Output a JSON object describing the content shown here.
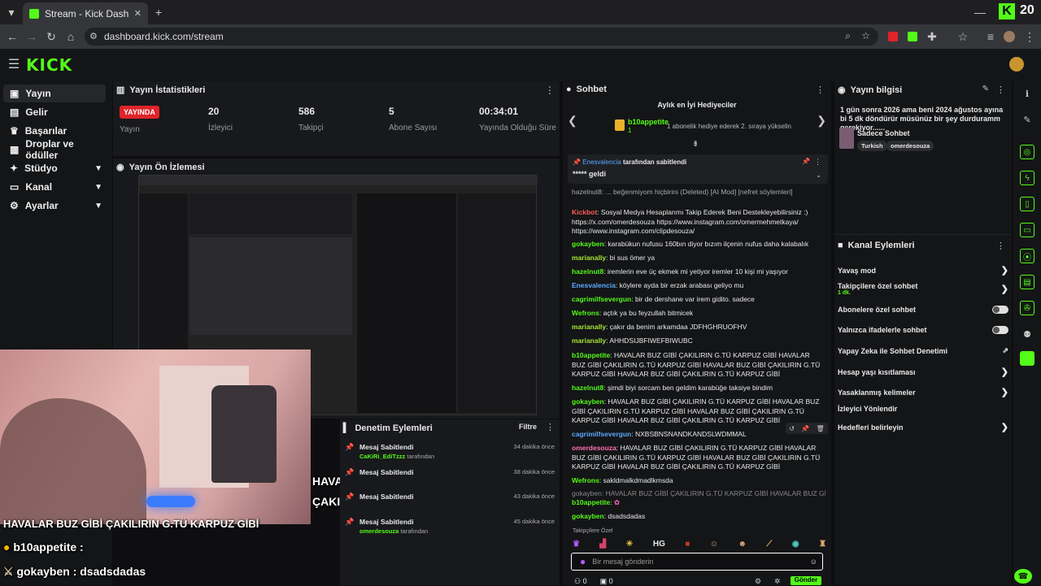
{
  "browser": {
    "tab_title": "Stream - Kick Dashboard",
    "url": "dashboard.kick.com/stream"
  },
  "logo": "KICK",
  "sidebar": {
    "items": [
      {
        "label": "Yayın",
        "icon": "broadcast-icon"
      },
      {
        "label": "Gelir",
        "icon": "wallet-icon"
      },
      {
        "label": "Başarılar",
        "icon": "trophy-icon"
      },
      {
        "label": "Droplar ve ödüller",
        "icon": "gift-icon"
      },
      {
        "label": "Stüdyo",
        "icon": "studio-icon"
      },
      {
        "label": "Kanal",
        "icon": "channel-icon"
      },
      {
        "label": "Ayarlar",
        "icon": "settings-icon"
      }
    ]
  },
  "stats": {
    "title": "Yayın İstatistikleri",
    "live_badge": "YAYINDA",
    "items": [
      {
        "label": "Yayın"
      },
      {
        "value": "20",
        "label": "İzleyici"
      },
      {
        "value": "586",
        "label": "Takipçi"
      },
      {
        "value": "5",
        "label": "Abone Sayısı"
      },
      {
        "value": "00:34:01",
        "label": "Yayında Olduğu Süre"
      }
    ]
  },
  "preview": {
    "title": "Yayın Ön İzlemesi"
  },
  "overlay": {
    "l1": "HAVALAR BUZ GİBİ",
    "l2": "ÇAKILIRIN G.TÜ KARPUZ GİBİ",
    "l3": "HAVALAR BUZ GİBİ ÇAKILIRIN G.TÜ KARPUZ GİBİ",
    "u1": "b10appetite :",
    "u2": "gokayben : dsadsdadas",
    "viewers": "20"
  },
  "moderation": {
    "title": "Denetim Eylemleri",
    "filter": "Filtre",
    "items": [
      {
        "title": "Mesaj Sabitlendi",
        "user": "CaKiRi_EdiTzzz",
        "suffix": "tarafından",
        "time": "34 dakika önce"
      },
      {
        "title": "Mesaj Sabitlendi",
        "user": "",
        "suffix": "",
        "time": "38 dakika önce"
      },
      {
        "title": "Mesaj Sabitlendi",
        "user": "",
        "suffix": "",
        "time": "43 dakika önce"
      },
      {
        "title": "Mesaj Sabitlendi",
        "user": "omerdesouza",
        "suffix": "tarafından",
        "time": "45 dakika önce"
      }
    ]
  },
  "chat": {
    "title": "Sohbet",
    "top_gifters": "Aylık en İyi Hediyeciler",
    "gifter_name": "b10appetite",
    "gifter_count": "1",
    "gifter_hint": "1 abonelik hediye ederek 2. sıraya yükselin",
    "pinned_by": "Enesvalencia",
    "pinned_by_suffix": "tarafından sabitlendi",
    "pinned_text": "***** geldi",
    "cutoff": "hazelnut8: ... beğenmiyom hiçbirini (Deleted) [AI Mod] [nefret söylemleri]",
    "messages": [
      {
        "u": "Kickbot",
        "c": "u-red",
        "t": "Sosyal Medya Hesaplarımı Takip Ederek Beni Destekleyebilirsiniz :) https://x.com/omerdesouza https://www.instagram.com/omermehmetkaya/ https://www.instagram.com/clipdesouza/"
      },
      {
        "u": "gokayben",
        "c": "u-green",
        "t": "karabükun nufusu 160bın diyor bızım ilçenin nufus daha kalabalık"
      },
      {
        "u": "marianally",
        "c": "u-green",
        "t": "bi sus ömer ya"
      },
      {
        "u": "hazelnut8",
        "c": "u-green",
        "t": "iremlerin eve üç ekmek mi yetiyor iremler 10 kişi mi yaşıyor"
      },
      {
        "u": "Enesvalencia",
        "c": "u-blue",
        "t": "köylere ayda bir erzak arabası geliyo mu"
      },
      {
        "u": "cagrimilfsevergun",
        "c": "u-green",
        "t": "bir de dershane var irem gidito. sadece"
      },
      {
        "u": "Wefrons",
        "c": "u-green",
        "t": "açtık ya bu feyzullah bitmicek"
      },
      {
        "u": "marianally",
        "c": "u-green",
        "t": "çakır da benim arkamdaa JDFHGHRUOFHV"
      },
      {
        "u": "marianally",
        "c": "u-green",
        "t": "AHHDSIJBFIWEFBIWUBC"
      },
      {
        "u": "b10appetite",
        "c": "u-green",
        "t": "HAVALAR BUZ GİBİ ÇAKILIRIN G.TÜ KARPUZ GİBİ HAVALAR BUZ GİBİ ÇAKILIRIN G.TÜ KARPUZ GİBİ HAVALAR BUZ GİBİ ÇAKILIRIN G.TÜ KARPUZ GİBİ HAVALAR BUZ GİBİ ÇAKILIRIN G.TÜ KARPUZ GİBİ"
      },
      {
        "u": "hazelnut8",
        "c": "u-green",
        "t": "şimdi biyi sorcam ben geldim karabüğe taksiye bindim"
      },
      {
        "u": "gokayben",
        "c": "u-green",
        "t": "HAVALAR BUZ GİBİ ÇAKILIRIN G.TÜ KARPUZ GİBİ HAVALAR BUZ GİBİ ÇAKILIRIN G.TÜ KARPUZ GİBİ HAVALAR BUZ GİBİ ÇAKILIRIN G.TÜ KARPUZ GİBİ HAVALAR BUZ GİBİ ÇAKILIRIN G.TÜ KARPUZ GİBİ"
      },
      {
        "u": "cagrimilfsevergun",
        "c": "u-blue",
        "t": "NXBSBNSNANDKANDSLWDMMAL"
      },
      {
        "u": "omerdesouza",
        "c": "u-green",
        "t": "HAVALAR BUZ GİBİ ÇAKILIRIN G.TÜ KARPUZ GİBİ HAVALAR BUZ GİBİ ÇAKILIRIN G.TÜ KARPUZ GİBİ HAVALAR BUZ GİBİ ÇAKILIRIN G.TÜ KARPUZ GİBİ HAVALAR BUZ GİBİ ÇAKILIRIN G.TÜ KARPUZ GİBİ"
      },
      {
        "u": "Wefrons",
        "c": "u-green",
        "t": "sakldmalkdmadlkmsda"
      },
      {
        "u": "",
        "c": "u-green",
        "t": "gokayben: HAVALAR BUZ GİBİ ÇAKILIRIN G.TÜ KARPUZ GİBİ HAVALAR BUZ GİBİ ÇAKILIRI..."
      },
      {
        "u": "b10appetite",
        "c": "u-green",
        "t": ""
      },
      {
        "u": "gokayben",
        "c": "u-green",
        "t": "dsadsdadas"
      }
    ],
    "followers_only": "Takipçilere Özel",
    "emote_hg": "HG",
    "input_placeholder": "Bir mesaj gönderin",
    "send": "Gönder",
    "counter_a": "0",
    "counter_b": "0"
  },
  "info": {
    "title": "Yayın bilgisi",
    "stream_title": "1 gün sonra 2026 ama beni 2024 ağustos ayına bi 5 dk döndürür müsünüz bir şey durduramm gerekiyor......",
    "subline": "Sadece Sohbet",
    "tags": [
      "Turkish",
      "omerdesouza"
    ],
    "actions_title": "Kanal Eylemleri",
    "actions": [
      {
        "label": "Yavaş mod",
        "kind": "arrow"
      },
      {
        "label": "Takipçilere özel sohbet",
        "sub": "1 dk.",
        "kind": "arrow"
      },
      {
        "label": "Abonelere özel sohbet",
        "kind": "toggle"
      },
      {
        "label": "Yalnızca ifadelerle sohbet",
        "kind": "toggle"
      },
      {
        "label": "Yapay Zeka ile Sohbet Denetimi",
        "kind": "link"
      },
      {
        "label": "Hesap yaşı kısıtlaması",
        "kind": "arrow"
      },
      {
        "label": "Yasaklanmış kelimeler",
        "kind": "arrow"
      },
      {
        "label": "İzleyici Yönlendir",
        "kind": "none"
      },
      {
        "label": "Hedefleri belirleyin",
        "kind": "arrow"
      }
    ]
  },
  "colors": {
    "accent": "#53fc18",
    "live": "#e0242a"
  }
}
